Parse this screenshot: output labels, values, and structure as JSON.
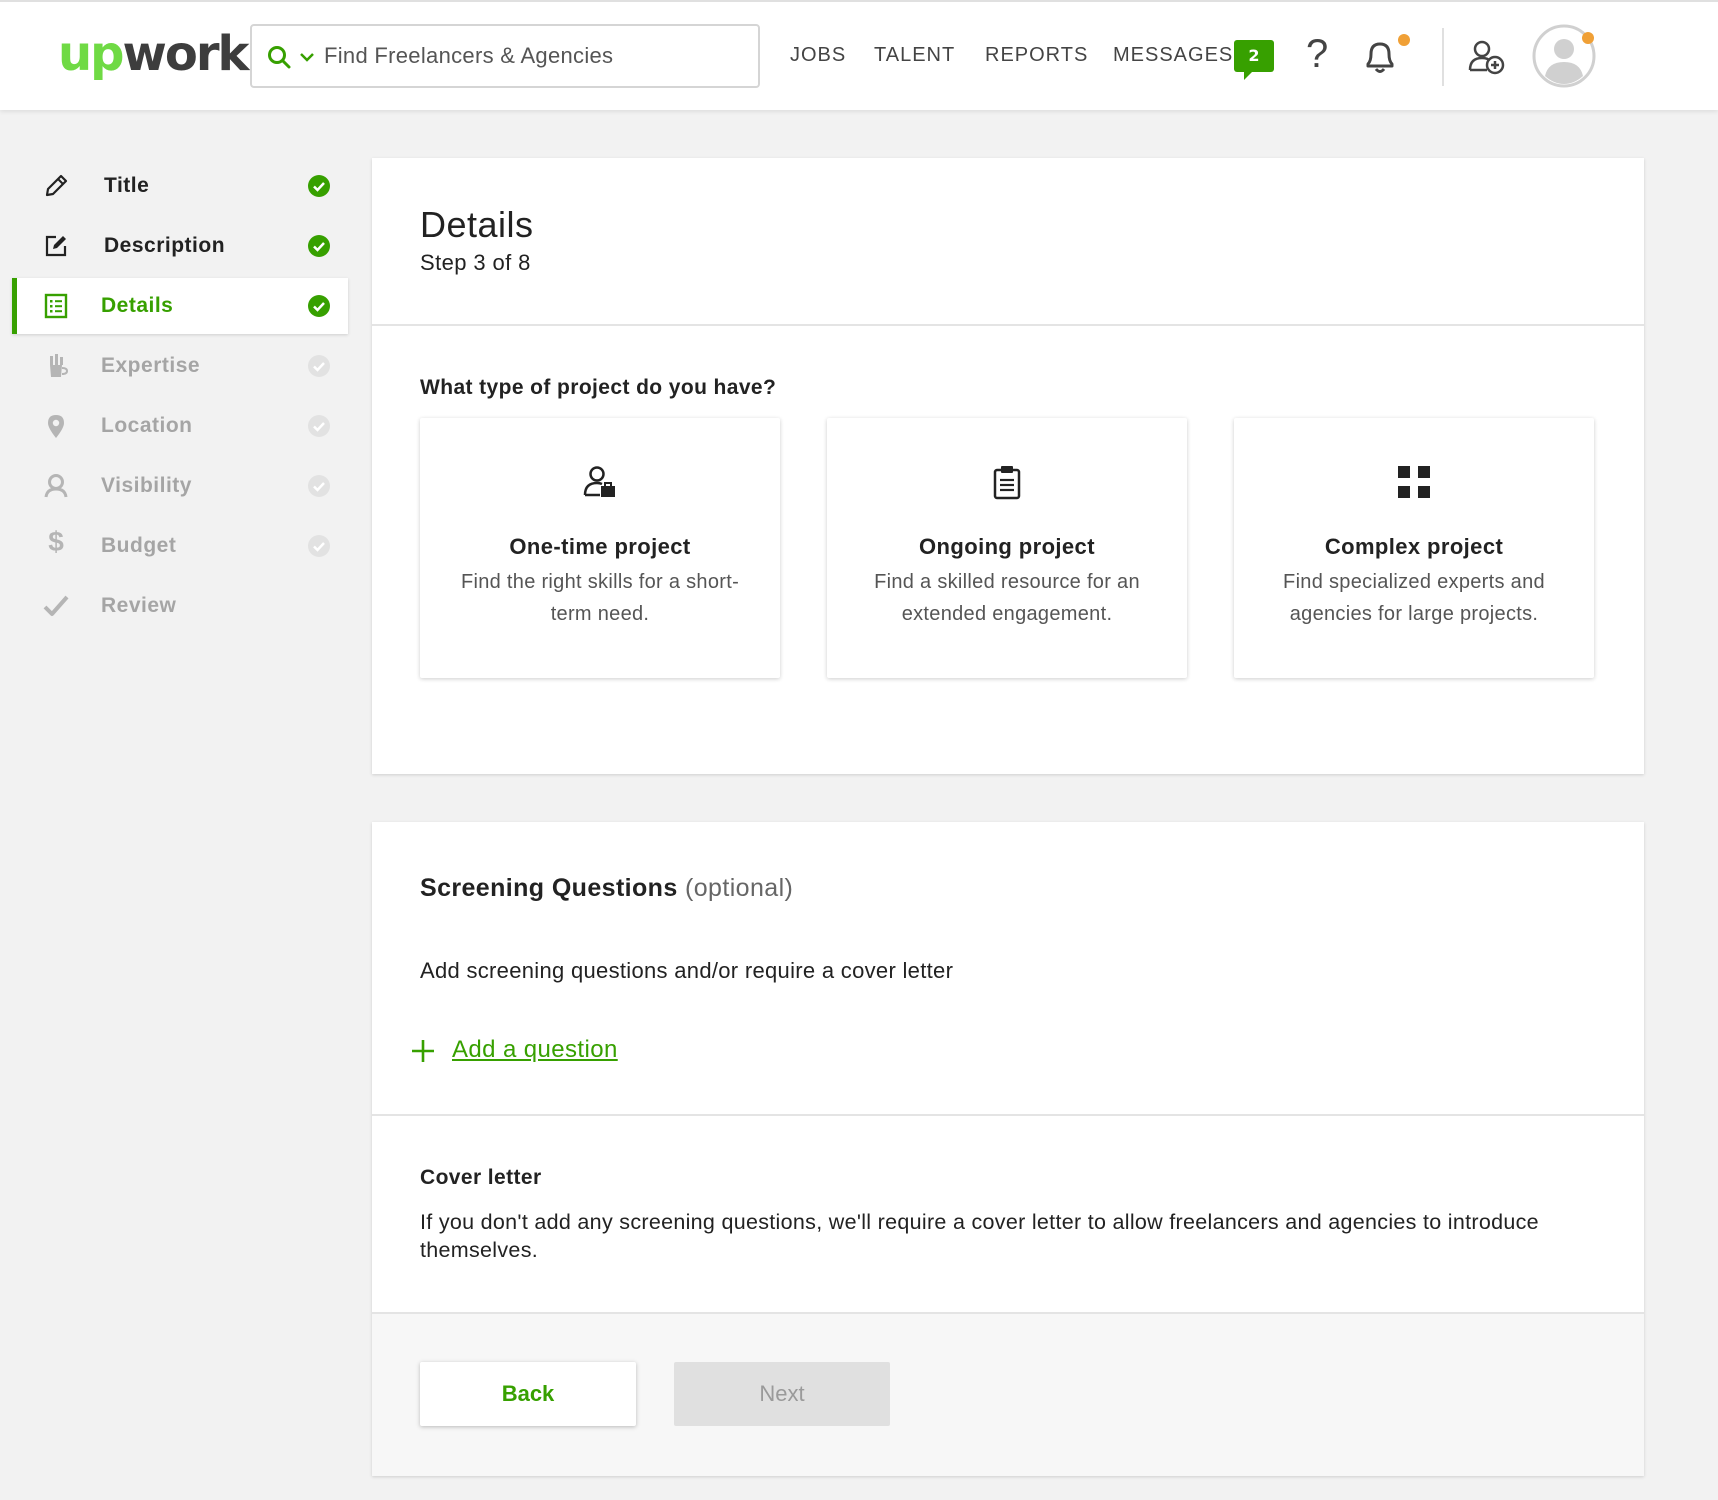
{
  "header": {
    "logo_up": "up",
    "logo_work": "work",
    "search_placeholder": "Find Freelancers & Agencies",
    "nav": {
      "jobs": "JOBS",
      "talent": "TALENT",
      "reports": "REPORTS",
      "messages": "MESSAGES",
      "messages_count": "2"
    },
    "help": "?"
  },
  "sidebar": {
    "items": [
      {
        "label": "Title",
        "icon": "pencil-icon",
        "state": "done"
      },
      {
        "label": "Description",
        "icon": "edit-icon",
        "state": "done"
      },
      {
        "label": "Details",
        "icon": "list-icon",
        "state": "active"
      },
      {
        "label": "Expertise",
        "icon": "tools-icon",
        "state": "pending"
      },
      {
        "label": "Location",
        "icon": "location-pin-icon",
        "state": "pending"
      },
      {
        "label": "Visibility",
        "icon": "user-icon",
        "state": "pending"
      },
      {
        "label": "Budget",
        "icon": "dollar-icon",
        "state": "pending"
      },
      {
        "label": "Review",
        "icon": "checkmark-icon",
        "state": "pending"
      }
    ]
  },
  "details": {
    "title": "Details",
    "step": "Step 3 of 8",
    "question": "What type of project do you have?",
    "project_types": [
      {
        "title": "One-time project",
        "desc": "Find the right skills for a short-term need.",
        "icon": "user-briefcase-icon"
      },
      {
        "title": "Ongoing project",
        "desc": "Find a skilled resource for an extended engagement.",
        "icon": "clipboard-icon"
      },
      {
        "title": "Complex project",
        "desc": "Find specialized experts and agencies for large projects.",
        "icon": "grid-icon"
      }
    ]
  },
  "screening": {
    "title": "Screening Questions",
    "optional": "(optional)",
    "subtitle": "Add screening questions and/or require a cover letter",
    "add_question": "Add a question"
  },
  "cover_letter": {
    "title": "Cover letter",
    "text": "If you don't add any screening questions, we'll require a cover letter to allow freelancers and agencies to introduce themselves."
  },
  "actions": {
    "back": "Back",
    "next": "Next"
  },
  "colors": {
    "brand_green": "#37a000",
    "logo_green": "#6fda44",
    "notification_orange": "#f0a036",
    "disabled_gray": "#e0e0e0"
  }
}
